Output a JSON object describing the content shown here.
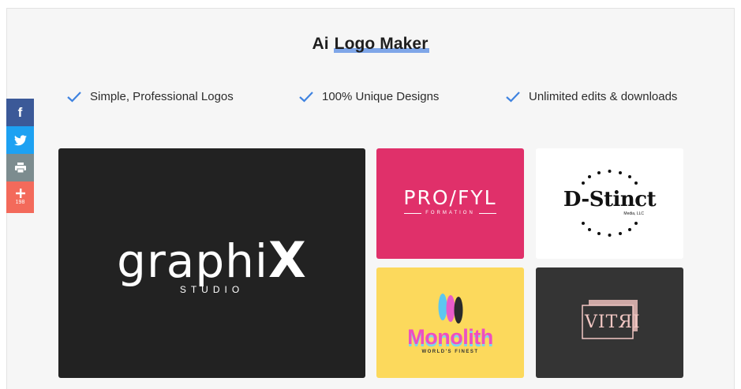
{
  "page": {
    "title_prefix": "Ai",
    "title_highlight": "Logo Maker"
  },
  "features": [
    {
      "label": "Simple, Professional Logos",
      "icon": "check-icon"
    },
    {
      "label": "100% Unique Designs",
      "icon": "check-icon"
    },
    {
      "label": "Unlimited edits & downloads",
      "icon": "check-icon"
    }
  ],
  "social": {
    "facebook_icon": "f",
    "share_count": "198"
  },
  "logos": {
    "graphix": {
      "name": "graphi",
      "name_mark": "X",
      "sub": "STUDIO"
    },
    "proofyl": {
      "name": "PRO/FYL",
      "sub": "FORMATION"
    },
    "dstinct": {
      "name": "D-Stinct",
      "sub": "Media, LLC"
    },
    "monolith": {
      "name": "Monolith",
      "sub": "WORLD'S FINEST"
    },
    "vitri": {
      "name": "VITЯI"
    }
  },
  "colors": {
    "accent_check": "#3f83e0",
    "highlight": "#7fa6e8",
    "facebook": "#3b5998",
    "twitter": "#1da1f2",
    "print": "#7c8c8f",
    "more": "#f36a5b"
  }
}
